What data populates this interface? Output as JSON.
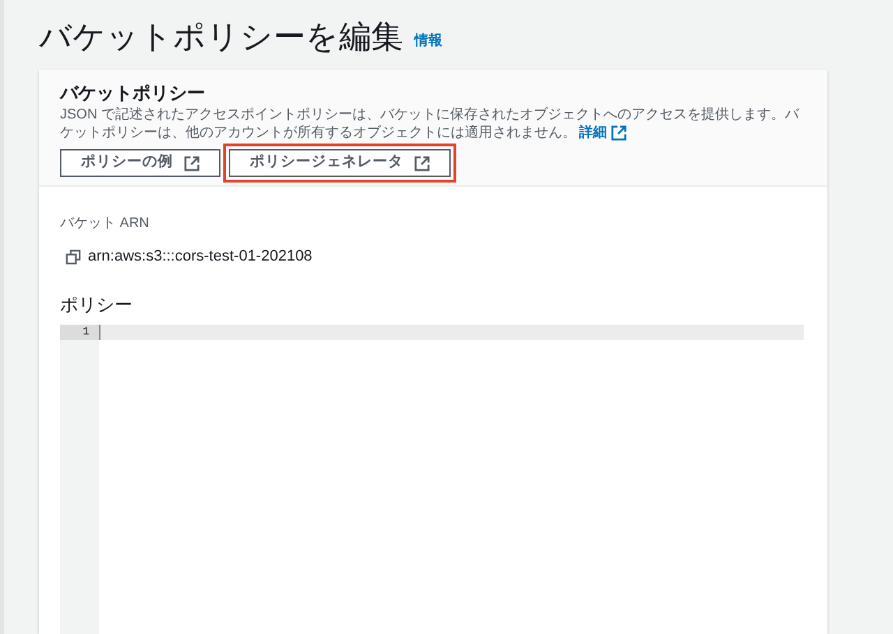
{
  "page": {
    "title": "バケットポリシーを編集",
    "info_link": "情報"
  },
  "panel": {
    "title": "バケットポリシー",
    "description": "JSON で記述されたアクセスポイントポリシーは、バケットに保存されたオブジェクトへのアクセスを提供します。バケットポリシーは、他のアカウントが所有するオブジェクトには適用されません。",
    "details_link": "詳細",
    "buttons": [
      {
        "label": "ポリシーの例",
        "highlighted": false
      },
      {
        "label": "ポリシージェネレータ",
        "highlighted": true
      }
    ]
  },
  "arn": {
    "label": "バケット ARN",
    "value": "arn:aws:s3:::cors-test-01-202108"
  },
  "policy": {
    "label": "ポリシー",
    "line_numbers": [
      "1"
    ]
  }
}
